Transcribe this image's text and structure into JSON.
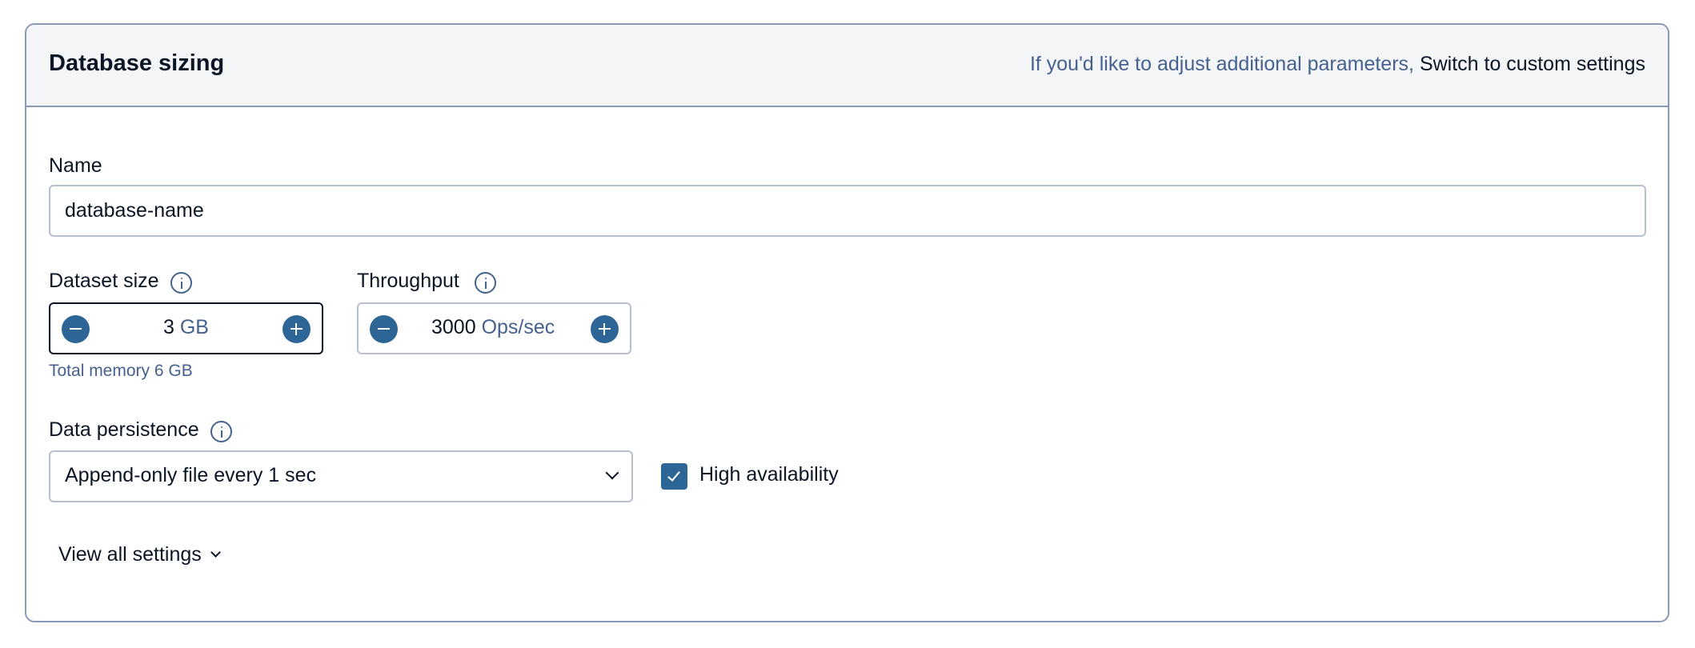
{
  "header": {
    "title": "Database sizing",
    "hint_text": "If you'd like to adjust additional parameters,",
    "custom_settings_link": "Switch to custom settings"
  },
  "name_field": {
    "label": "Name",
    "value": "database-name"
  },
  "dataset_size": {
    "label": "Dataset size",
    "value": "3",
    "unit": "GB",
    "helper_text": "Total memory 6 GB"
  },
  "throughput": {
    "label": "Throughput",
    "value": "3000",
    "unit": "Ops/sec"
  },
  "data_persistence": {
    "label": "Data persistence",
    "selected_option": "Append-only file every 1 sec"
  },
  "high_availability": {
    "label": "High availability",
    "checked": true
  },
  "view_all_settings": {
    "label": "View all settings"
  },
  "icons": {
    "info": "info-icon",
    "minus": "minus-icon",
    "plus": "plus-icon",
    "chevron": "chevron-down-icon",
    "check": "checkmark-icon"
  },
  "colors": {
    "accent": "#2d6696",
    "border": "#8a99b6",
    "muted_text": "#45618f",
    "header_bg": "#f4f5f7"
  }
}
